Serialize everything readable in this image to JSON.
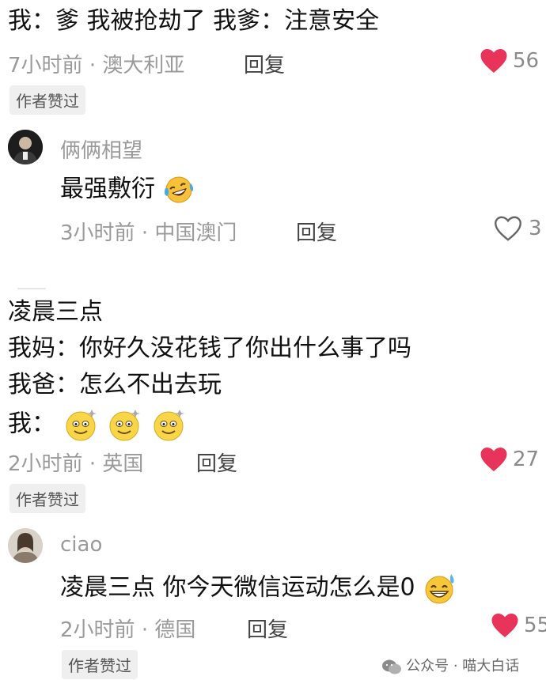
{
  "comments": [
    {
      "text": "我：爹 我被抢劫了 我爹：注意安全",
      "time": "7小时前",
      "location": "澳大利亚",
      "reply_label": "回复",
      "likes": "56",
      "liked": true,
      "badge": "作者赞过"
    },
    {
      "username": "俩俩相望",
      "text": "最强敷衍",
      "time": "3小时前",
      "location": "中国澳门",
      "reply_label": "回复",
      "likes": "3",
      "liked": false
    },
    {
      "lines": [
        "凌晨三点",
        "我妈：你好久没花钱了你出什么事了吗",
        "我爸：怎么不出去玩",
        "我："
      ],
      "time": "2小时前",
      "location": "英国",
      "reply_label": "回复",
      "likes": "27",
      "liked": true,
      "badge": "作者赞过"
    },
    {
      "username": "ciao",
      "text": "凌晨三点 你今天微信运动怎么是0",
      "time": "2小时前",
      "location": "德国",
      "reply_label": "回复",
      "likes": "55",
      "liked": true,
      "badge": "作者赞过"
    }
  ],
  "separator": "·",
  "watermark": {
    "icon": "wechat-icon",
    "text": "公众号 · 喵大白话"
  },
  "colors": {
    "heart_red": "#e8345a",
    "meta_gray": "#9a9a9a",
    "badge_bg": "#efefef"
  }
}
